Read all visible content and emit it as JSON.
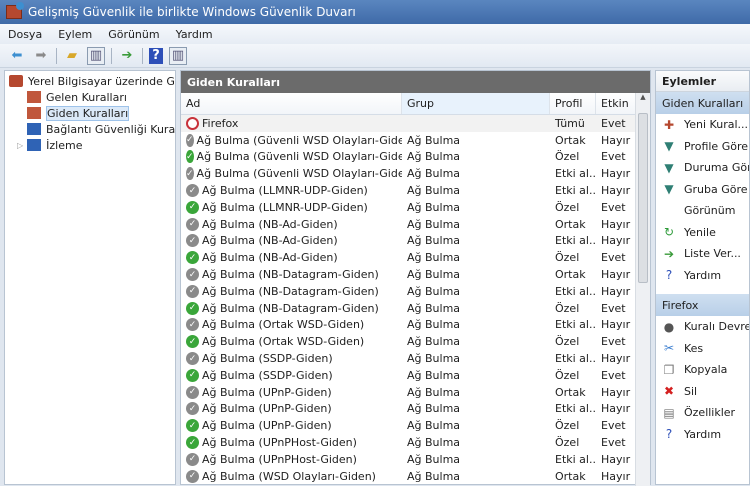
{
  "window": {
    "title": "Gelişmiş Güvenlik ile birlikte Windows Güvenlik Duvarı"
  },
  "menu": [
    "Dosya",
    "Eylem",
    "Görünüm",
    "Yardım"
  ],
  "toolbar": [
    "back-icon",
    "forward-icon",
    "up-folder-icon",
    "show-hide-tree-icon",
    "export-icon",
    "help-icon",
    "show-hide-action-icon"
  ],
  "tree": {
    "root": "Yerel Bilgisayar üzerinde Gelişmiş Güvenlik ile birlikte Windows Güvenlik Duvarı",
    "items": [
      "Gelen Kuralları",
      "Giden Kuralları",
      "Bağlantı Güvenliği Kuralları",
      "İzleme"
    ],
    "selected": "Giden Kuralları"
  },
  "main": {
    "title": "Giden Kuralları",
    "columns": [
      "Ad",
      "Grup",
      "Profil",
      "Etkin"
    ],
    "rows": [
      {
        "name": "Firefox",
        "group": "",
        "profile": "Tümü",
        "enabled": "Evet",
        "icon": "block"
      },
      {
        "name": "Ağ Bulma (Güvenli WSD Olayları-Giden)",
        "group": "Ağ Bulma",
        "profile": "Ortak",
        "enabled": "Hayır",
        "icon": "off"
      },
      {
        "name": "Ağ Bulma (Güvenli WSD Olayları-Giden)",
        "group": "Ağ Bulma",
        "profile": "Özel",
        "enabled": "Evet",
        "icon": "on"
      },
      {
        "name": "Ağ Bulma (Güvenli WSD Olayları-Giden)",
        "group": "Ağ Bulma",
        "profile": "Etki al...",
        "enabled": "Hayır",
        "icon": "off"
      },
      {
        "name": "Ağ Bulma (LLMNR-UDP-Giden)",
        "group": "Ağ Bulma",
        "profile": "Etki al...",
        "enabled": "Hayır",
        "icon": "off"
      },
      {
        "name": "Ağ Bulma (LLMNR-UDP-Giden)",
        "group": "Ağ Bulma",
        "profile": "Özel",
        "enabled": "Evet",
        "icon": "on"
      },
      {
        "name": "Ağ Bulma (NB-Ad-Giden)",
        "group": "Ağ Bulma",
        "profile": "Ortak",
        "enabled": "Hayır",
        "icon": "off"
      },
      {
        "name": "Ağ Bulma (NB-Ad-Giden)",
        "group": "Ağ Bulma",
        "profile": "Etki al...",
        "enabled": "Hayır",
        "icon": "off"
      },
      {
        "name": "Ağ Bulma (NB-Ad-Giden)",
        "group": "Ağ Bulma",
        "profile": "Özel",
        "enabled": "Evet",
        "icon": "on"
      },
      {
        "name": "Ağ Bulma (NB-Datagram-Giden)",
        "group": "Ağ Bulma",
        "profile": "Ortak",
        "enabled": "Hayır",
        "icon": "off"
      },
      {
        "name": "Ağ Bulma (NB-Datagram-Giden)",
        "group": "Ağ Bulma",
        "profile": "Etki al...",
        "enabled": "Hayır",
        "icon": "off"
      },
      {
        "name": "Ağ Bulma (NB-Datagram-Giden)",
        "group": "Ağ Bulma",
        "profile": "Özel",
        "enabled": "Evet",
        "icon": "on"
      },
      {
        "name": "Ağ Bulma (Ortak WSD-Giden)",
        "group": "Ağ Bulma",
        "profile": "Etki al...",
        "enabled": "Hayır",
        "icon": "off"
      },
      {
        "name": "Ağ Bulma (Ortak WSD-Giden)",
        "group": "Ağ Bulma",
        "profile": "Özel",
        "enabled": "Evet",
        "icon": "on"
      },
      {
        "name": "Ağ Bulma (SSDP-Giden)",
        "group": "Ağ Bulma",
        "profile": "Etki al...",
        "enabled": "Hayır",
        "icon": "off"
      },
      {
        "name": "Ağ Bulma (SSDP-Giden)",
        "group": "Ağ Bulma",
        "profile": "Özel",
        "enabled": "Evet",
        "icon": "on"
      },
      {
        "name": "Ağ Bulma (UPnP-Giden)",
        "group": "Ağ Bulma",
        "profile": "Ortak",
        "enabled": "Hayır",
        "icon": "off"
      },
      {
        "name": "Ağ Bulma (UPnP-Giden)",
        "group": "Ağ Bulma",
        "profile": "Etki al...",
        "enabled": "Hayır",
        "icon": "off"
      },
      {
        "name": "Ağ Bulma (UPnP-Giden)",
        "group": "Ağ Bulma",
        "profile": "Özel",
        "enabled": "Evet",
        "icon": "on"
      },
      {
        "name": "Ağ Bulma (UPnPHost-Giden)",
        "group": "Ağ Bulma",
        "profile": "Özel",
        "enabled": "Evet",
        "icon": "on"
      },
      {
        "name": "Ağ Bulma (UPnPHost-Giden)",
        "group": "Ağ Bulma",
        "profile": "Etki al...",
        "enabled": "Hayır",
        "icon": "off"
      },
      {
        "name": "Ağ Bulma (WSD Olayları-Giden)",
        "group": "Ağ Bulma",
        "profile": "Ortak",
        "enabled": "Hayır",
        "icon": "off"
      }
    ]
  },
  "actions": {
    "title": "Eylemler",
    "sections": [
      {
        "title": "Giden Kuralları",
        "items": [
          {
            "label": "Yeni Kural...",
            "icon": "new-rule-icon",
            "glyph": "✚",
            "color": "#b5482f"
          },
          {
            "label": "Profile Göre Filtrele",
            "icon": "filter-icon",
            "glyph": "▼",
            "color": "#2f7f74"
          },
          {
            "label": "Duruma Göre Filtrele",
            "icon": "filter-icon",
            "glyph": "▼",
            "color": "#2f7f74"
          },
          {
            "label": "Gruba Göre Filtrele",
            "icon": "filter-icon",
            "glyph": "▼",
            "color": "#2f7f74"
          },
          {
            "label": "Görünüm",
            "icon": "",
            "glyph": "",
            "color": ""
          },
          {
            "label": "Yenile",
            "icon": "refresh-icon",
            "glyph": "↻",
            "color": "#2e9b3a"
          },
          {
            "label": "Liste Ver...",
            "icon": "export-icon",
            "glyph": "➔",
            "color": "#3a9b3a"
          },
          {
            "label": "Yardım",
            "icon": "help-icon",
            "glyph": "?",
            "color": "#2d4fb8"
          }
        ]
      },
      {
        "title": "Firefox",
        "items": [
          {
            "label": "Kuralı Devre Dışı Bırak",
            "icon": "disable-rule-icon",
            "glyph": "●",
            "color": "#555"
          },
          {
            "label": "Kes",
            "icon": "cut-icon",
            "glyph": "✂",
            "color": "#3d7fd0"
          },
          {
            "label": "Kopyala",
            "icon": "copy-icon",
            "glyph": "❐",
            "color": "#777"
          },
          {
            "label": "Sil",
            "icon": "delete-icon",
            "glyph": "✖",
            "color": "#d42020"
          },
          {
            "label": "Özellikler",
            "icon": "properties-icon",
            "glyph": "▤",
            "color": "#777"
          },
          {
            "label": "Yardım",
            "icon": "help-icon",
            "glyph": "?",
            "color": "#2d4fb8"
          }
        ]
      }
    ]
  }
}
